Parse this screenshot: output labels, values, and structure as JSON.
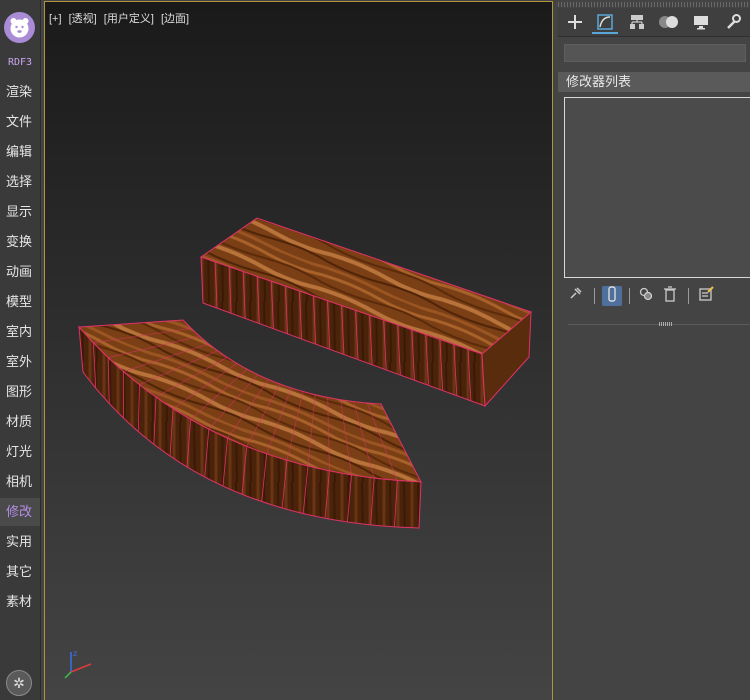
{
  "sidebar": {
    "brand": "RDF3",
    "items": [
      {
        "label": "渲染"
      },
      {
        "label": "文件"
      },
      {
        "label": "编辑"
      },
      {
        "label": "选择"
      },
      {
        "label": "显示"
      },
      {
        "label": "变换"
      },
      {
        "label": "动画"
      },
      {
        "label": "模型"
      },
      {
        "label": "室内"
      },
      {
        "label": "室外"
      },
      {
        "label": "图形"
      },
      {
        "label": "材质"
      },
      {
        "label": "灯光"
      },
      {
        "label": "相机"
      },
      {
        "label": "修改",
        "active": true
      },
      {
        "label": "实用"
      },
      {
        "label": "其它"
      },
      {
        "label": "素材"
      }
    ],
    "accent_color": "#b48ee8"
  },
  "viewport": {
    "label_plus": "[+]",
    "label_view": "[透视]",
    "label_custom": "[用户定义]",
    "label_shading": "[边面]",
    "border_color": "#b0953c",
    "edge_color": "#e0316a"
  },
  "command_panel": {
    "tabs": [
      "create-icon",
      "modify-icon",
      "hierarchy-icon",
      "motion-icon",
      "display-icon",
      "utilities-icon"
    ],
    "active_tab": "modify-icon",
    "object_name": "",
    "modifier_list_label": "修改器列表",
    "stack_tools": [
      "pin-stack-icon",
      "show-end-result-icon",
      "make-unique-icon",
      "remove-modifier-icon",
      "configure-modifier-sets-icon"
    ]
  }
}
